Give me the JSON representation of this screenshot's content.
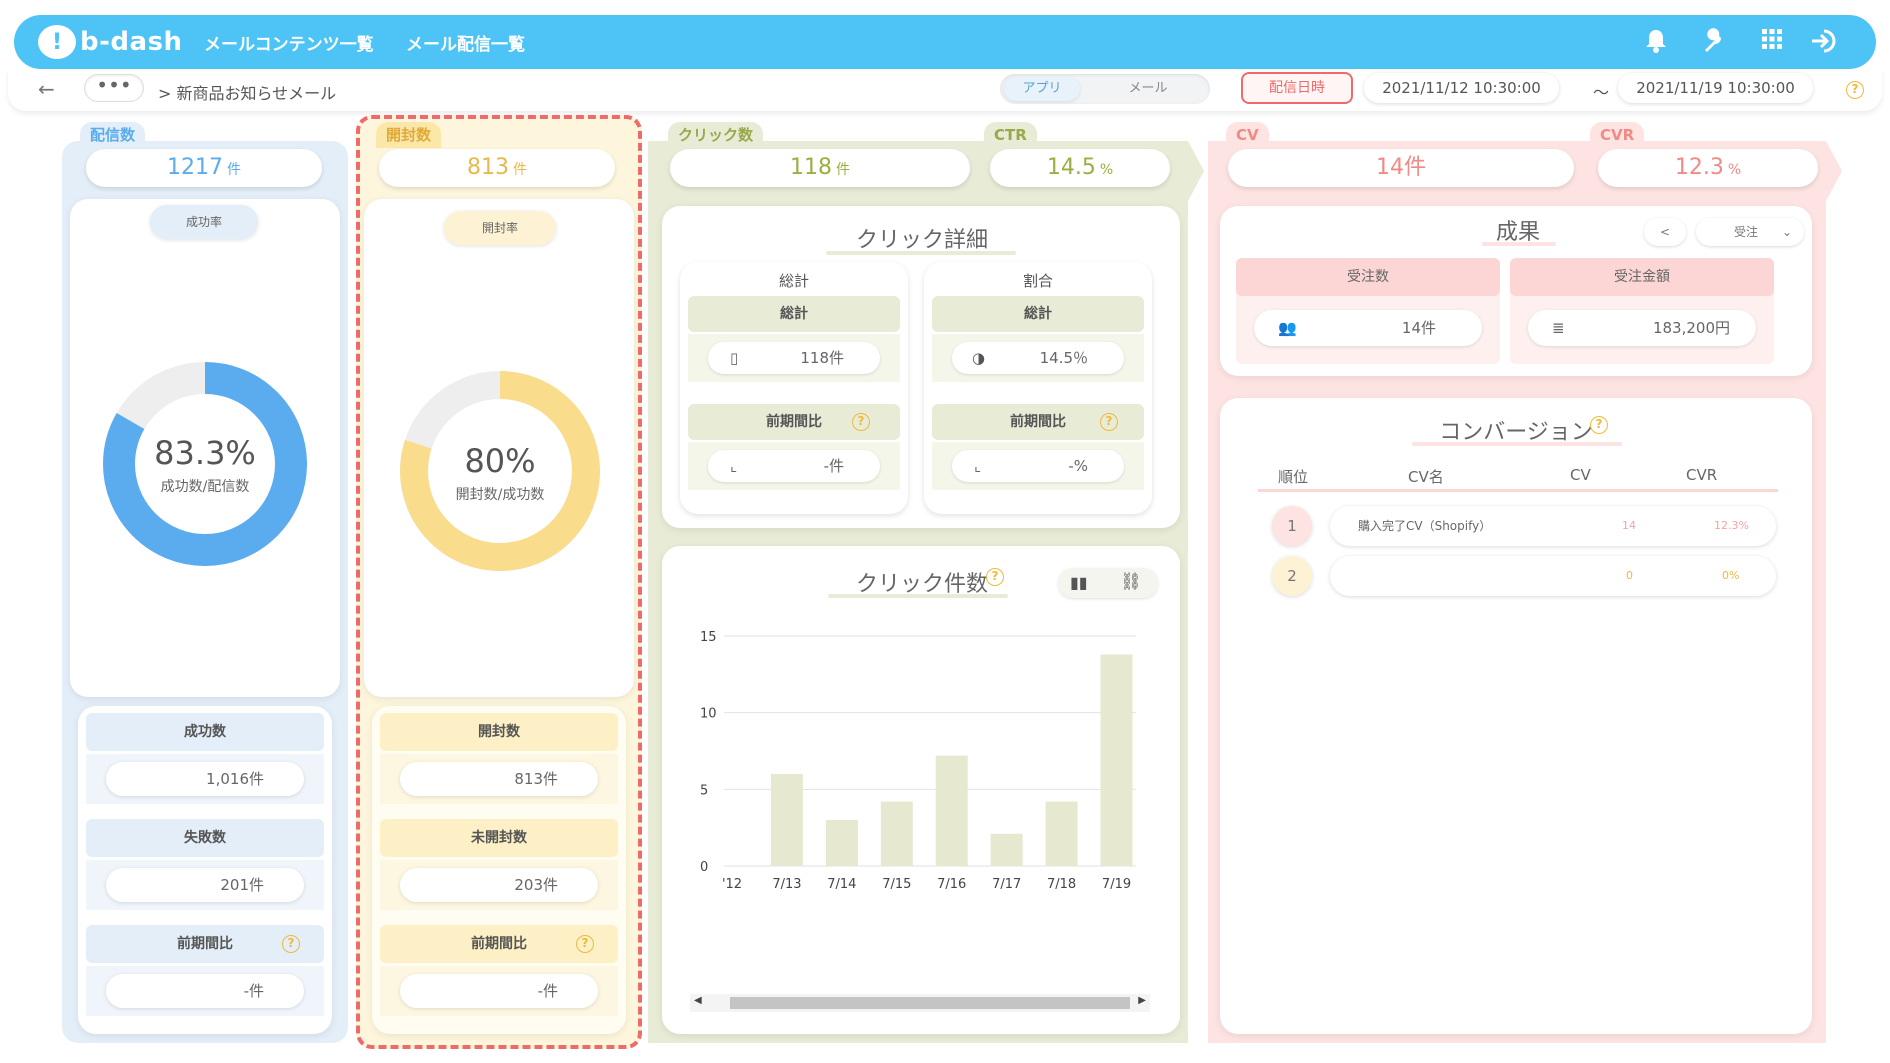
{
  "header": {
    "logo_text": "b-dash",
    "nav": [
      "メールコンテンツ一覧",
      "メール配信一覧"
    ]
  },
  "subbar": {
    "more": "•••",
    "breadcrumb": "> 新商品お知らせメール",
    "toggle": [
      "アプリ",
      "メール"
    ],
    "date_button": "配信日時",
    "date_from": "2021/11/12 10:30:00",
    "tilde": "〜",
    "date_to": "2021/11/19 10:30:00"
  },
  "delivery": {
    "tag": "配信数",
    "kpi_value": "1217",
    "kpi_unit": "件",
    "pill": "成功率",
    "donut_value": "83.3%",
    "donut_label": "成功数/配信数",
    "donut_fraction": 0.833,
    "rows": [
      {
        "label": "成功数",
        "value": "1,016件"
      },
      {
        "label": "失敗数",
        "value": "201件"
      },
      {
        "label": "前期間比",
        "value": "-件"
      }
    ]
  },
  "opens": {
    "tag": "開封数",
    "kpi_value": "813",
    "kpi_unit": "件",
    "pill": "開封率",
    "donut_value": "80%",
    "donut_label": "開封数/成功数",
    "donut_fraction": 0.8,
    "rows": [
      {
        "label": "開封数",
        "value": "813件"
      },
      {
        "label": "未開封数",
        "value": "203件"
      },
      {
        "label": "前期間比",
        "value": "-件"
      }
    ]
  },
  "clicks": {
    "tag": "クリック数",
    "kpi_value": "118",
    "kpi_unit": "件",
    "ctr_tag": "CTR",
    "ctr_value": "14.5",
    "ctr_unit": "%",
    "detail_title": "クリック詳細",
    "left_card": {
      "title": "総計",
      "hdr1": "総計",
      "val1": "118件",
      "hdr2": "前期間比",
      "val2": "-件"
    },
    "right_card": {
      "title": "割合",
      "hdr1": "総計",
      "val1": "14.5％",
      "hdr2": "前期間比",
      "val2": "-%"
    },
    "chart_title": "クリック件数"
  },
  "cv": {
    "tag": "CV",
    "kpi_value": "14件",
    "cvr_tag": "CVR",
    "cvr_value": "12.3",
    "cvr_unit": "%",
    "results_title": "成果",
    "select_value": "受注",
    "col1": "受注数",
    "col2": "受注金額",
    "val1": "14件",
    "val2": "183,200円",
    "conversion_title": "コンバージョン",
    "table_headers": [
      "順位",
      "CV名",
      "CV",
      "CVR"
    ],
    "rows": [
      {
        "rank": "1",
        "name": "購入完了CV（Shopify）",
        "cv": "14",
        "cvr": "12.3%"
      },
      {
        "rank": "2",
        "name": "",
        "cv": "0",
        "cvr": "0%"
      }
    ]
  },
  "colors": {
    "blue": "#5aacef",
    "yellow": "#f9dd8c",
    "olive": "#e6e9cf",
    "pink": "#f7c8c6",
    "accent_red": "#ee6b6b"
  },
  "chart_data": {
    "type": "bar",
    "categories": [
      "7/12",
      "7/13",
      "7/14",
      "7/15",
      "7/16",
      "7/17",
      "7/18",
      "7/19"
    ],
    "tick_labels": [
      "'12",
      "7/13",
      "7/14",
      "7/15",
      "7/16",
      "7/17",
      "7/18",
      "7/19"
    ],
    "values": [
      null,
      6,
      3,
      4.2,
      7.2,
      2.1,
      4.2,
      13.8
    ],
    "yticks": [
      0,
      5,
      10,
      15
    ],
    "ylim": [
      0,
      15
    ],
    "title": "クリック件数",
    "xlabel": "",
    "ylabel": "",
    "grid": true
  }
}
